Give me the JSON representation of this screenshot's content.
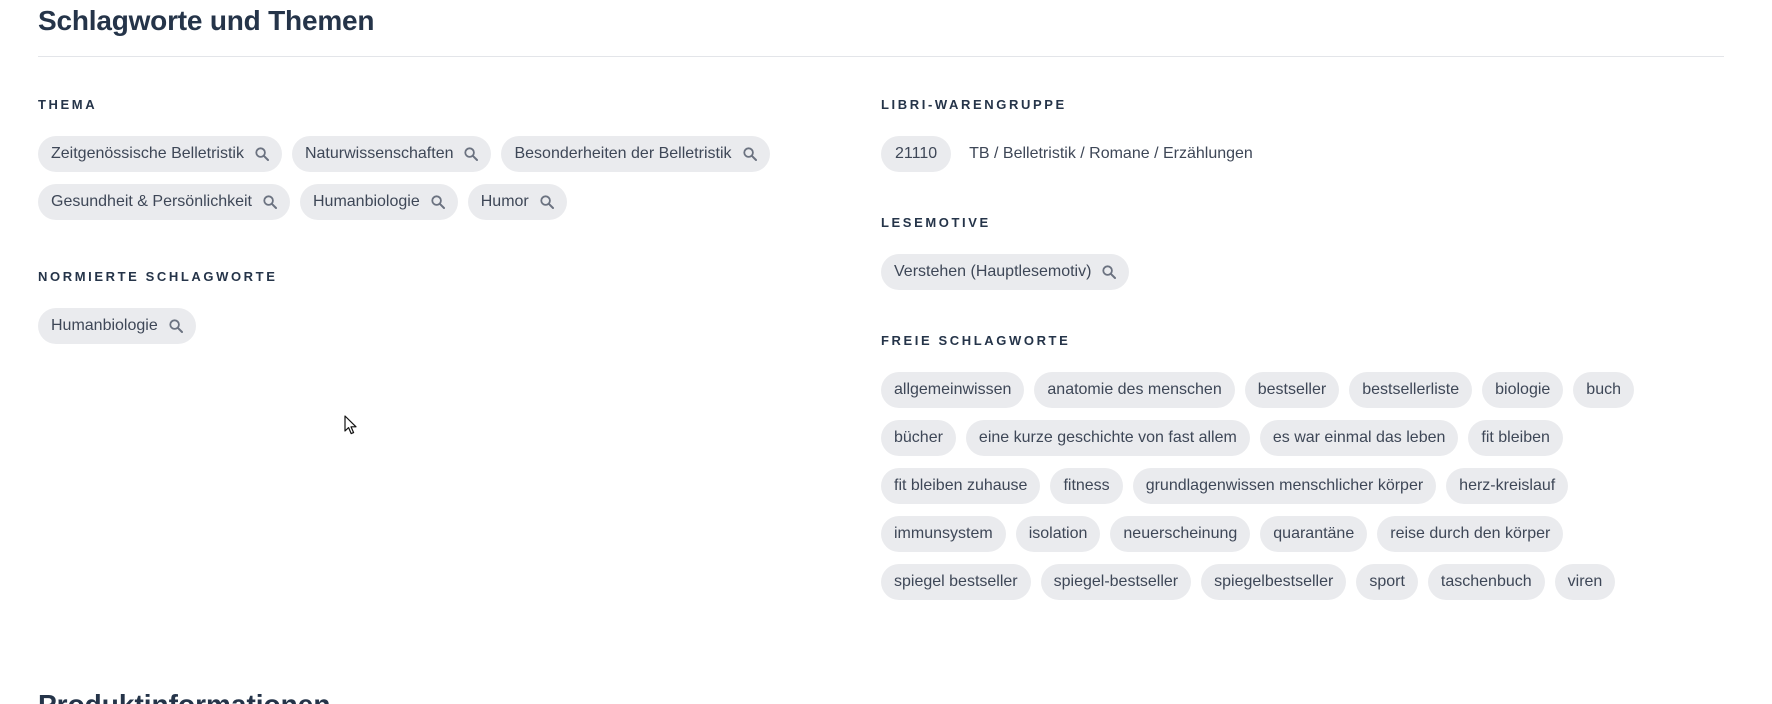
{
  "section": {
    "title": "Schlagworte und Themen"
  },
  "thema": {
    "label": "THEMA",
    "items": [
      {
        "label": "Zeitgenössische Belletristik"
      },
      {
        "label": "Naturwissenschaften"
      },
      {
        "label": "Besonderheiten der Belletristik"
      },
      {
        "label": "Gesundheit & Persönlichkeit"
      },
      {
        "label": "Humanbiologie"
      },
      {
        "label": "Humor"
      }
    ]
  },
  "normiert": {
    "label": "NORMIERTE SCHLAGWORTE",
    "items": [
      {
        "label": "Humanbiologie"
      }
    ]
  },
  "libri": {
    "label": "LIBRI-WARENGRUPPE",
    "code": "21110",
    "description": "TB / Belletristik / Romane / Erzählungen"
  },
  "lesemotive": {
    "label": "LESEMOTIVE",
    "items": [
      {
        "label": "Verstehen (Hauptlesemotiv)"
      }
    ]
  },
  "freie": {
    "label": "FREIE SCHLAGWORTE",
    "items": [
      {
        "label": "allgemeinwissen"
      },
      {
        "label": "anatomie des menschen"
      },
      {
        "label": "bestseller"
      },
      {
        "label": "bestsellerliste"
      },
      {
        "label": "biologie"
      },
      {
        "label": "buch"
      },
      {
        "label": "bücher"
      },
      {
        "label": "eine kurze geschichte von fast allem"
      },
      {
        "label": "es war einmal das leben"
      },
      {
        "label": "fit bleiben"
      },
      {
        "label": "fit bleiben zuhause"
      },
      {
        "label": "fitness"
      },
      {
        "label": "grundlagenwissen menschlicher körper"
      },
      {
        "label": "herz-kreislauf"
      },
      {
        "label": "immunsystem"
      },
      {
        "label": "isolation"
      },
      {
        "label": "neuerscheinung"
      },
      {
        "label": "quarantäne"
      },
      {
        "label": "reise durch den körper"
      },
      {
        "label": "spiegel bestseller"
      },
      {
        "label": "spiegel-bestseller"
      },
      {
        "label": "spiegelbestseller"
      },
      {
        "label": "sport"
      },
      {
        "label": "taschenbuch"
      },
      {
        "label": "viren"
      }
    ]
  },
  "next_section": {
    "title": "Produktinformationen"
  },
  "icons": {
    "search": "search-icon",
    "cursor": "mouse-pointer-icon"
  },
  "colors": {
    "heading": "#253449",
    "chip_bg": "#eaebee",
    "chip_text": "#3e4757",
    "divider": "#e3e5e9",
    "icon": "#6b7280"
  }
}
